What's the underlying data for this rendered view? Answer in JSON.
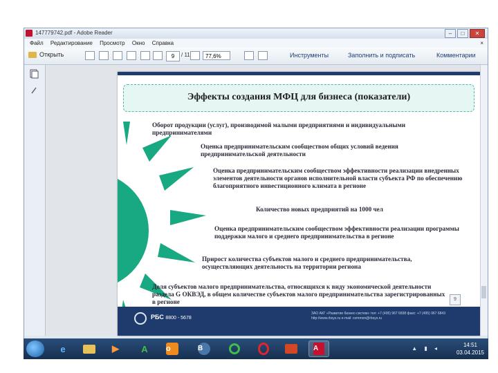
{
  "window": {
    "title": "147779742.pdf - Adobe Reader"
  },
  "menu": {
    "items": [
      "Файл",
      "Редактирование",
      "Просмотр",
      "Окно",
      "Справка"
    ],
    "close_doc": "×"
  },
  "toolbar": {
    "open_label": "Открыть",
    "page_current": "9",
    "page_total": "/ 11",
    "zoom": "77,6%",
    "tools_label": "Инструменты",
    "fill_sign_label": "Заполнить и подписать",
    "comments_label": "Комментарии"
  },
  "slide": {
    "title": "Эффекты создания МФЦ для бизнеса (показатели)",
    "items": [
      "Оборот продукции (услуг), производимой малыми предприятиями и индивидуальными предпринимателями",
      "Оценка предпринимательским сообществом общих условий ведения предпринимательской деятельности",
      "Оценка предпринимательским сообществом эффективности реализации внедренных элементов деятельности органов исполнительной власти субъекта РФ по обеспечению благоприятного инвестиционного климата в регионе",
      "Количество новых предприятий на 1000 чел",
      "Оценка предпринимательским сообществом эффективности реализации программы поддержки малого и среднего предпринимательства в регионе",
      "Прирост количества субъектов малого и среднего предпринимательства, осуществляющих деятельность на территории региона",
      "Доля субъектов малого предпринимательства, относящихся к виду экономической деятельности раздела G ОКВЭД, в общем количестве субъектов малого предпринимательства зарегистрированных в регионе"
    ],
    "page_number": "9",
    "footer_brand": "РБС",
    "footer_phone": "8800 - 5678",
    "footer_contacts": "ЗАО АКГ «Развитие бизнес-систем» тел: +7 (495) 967 6838 факс: +7 (495) 967 6843 http://www.rbsys.ru e-mail: common@rbsys.ru"
  },
  "taskbar": {
    "apps": [
      "explorer",
      "ie",
      "media",
      "a-app",
      "ok",
      "vk",
      "chat",
      "opera",
      "word",
      "acrobat"
    ],
    "time": "14:51",
    "date": "03.04.2015"
  },
  "colors": {
    "sun": "#18a882",
    "footer": "#1f3b6e",
    "accent_text": "#1b3f74"
  }
}
